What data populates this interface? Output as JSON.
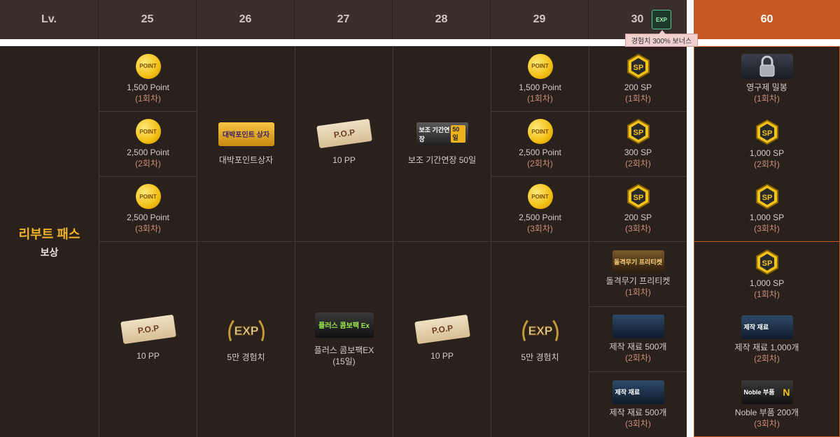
{
  "header": {
    "lv_label": "Lv.",
    "levels": [
      "25",
      "26",
      "27",
      "28",
      "29",
      "30"
    ],
    "exp_icon_text": "EXP",
    "bonus_tooltip": "경험치 300% 보너스",
    "special_level": "60"
  },
  "side": {
    "title": "리부트 패스",
    "subtitle": "보상"
  },
  "icons": {
    "point_coin": "POINT",
    "sp": "SP",
    "pp_ticket": "P.O.P",
    "exp_badge": "EXP"
  },
  "upper": {
    "c25": [
      {
        "label": "1,500 Point",
        "sub": "(1회차)"
      },
      {
        "label": "2,500 Point",
        "sub": "(2회차)"
      },
      {
        "label": "2,500 Point",
        "sub": "(3회차)"
      }
    ],
    "c26": {
      "label": "대박포인트상자",
      "icon_text": "대박포인트 상자"
    },
    "c27": {
      "label": "10 PP"
    },
    "c28": {
      "label": "보조 기간연장 50일",
      "icon_text": "보조 기간연장",
      "icon_badge": "50일"
    },
    "c29": [
      {
        "label": "1,500 Point",
        "sub": "(1회차)"
      },
      {
        "label": "2,500 Point",
        "sub": "(2회차)"
      },
      {
        "label": "2,500 Point",
        "sub": "(3회차)"
      }
    ],
    "c30": [
      {
        "label": "200 SP",
        "sub": "(1회차)"
      },
      {
        "label": "300 SP",
        "sub": "(2회차)"
      },
      {
        "label": "200 SP",
        "sub": "(3회차)"
      }
    ],
    "c60": [
      {
        "label": "영구제 밀봉",
        "sub": "(1회차)"
      },
      {
        "label": "1,000 SP",
        "sub": "(2회차)"
      },
      {
        "label": "1,000 SP",
        "sub": "(3회차)"
      }
    ]
  },
  "lower": {
    "c25": {
      "label": "10 PP"
    },
    "c26": {
      "label": "5만 경험치"
    },
    "c27": {
      "label": "플러스 콤보팩EX",
      "sub": "(15일)",
      "icon_text": "플러스 콤보팩 Ex"
    },
    "c28": {
      "label": "10 PP"
    },
    "c29": {
      "label": "5만 경험치"
    },
    "c30": [
      {
        "label": "돌격무기 프리티켓",
        "sub": "(1회차)",
        "icon_text": "돌격무기 프리티켓"
      },
      {
        "label": "제작 재료 500개",
        "sub": "(2회차)"
      },
      {
        "label": "제작 재료 500개",
        "sub": "(3회차)",
        "icon_text": "제작 재료"
      }
    ],
    "c60": [
      {
        "label": "1,000 SP",
        "sub": "(1회차)"
      },
      {
        "label": "제작 재료 1,000개",
        "sub": "(2회차)",
        "icon_text": "제작 재료"
      },
      {
        "label": "Noble 부품 200개",
        "sub": "(3회차)",
        "icon_text": "Noble 부품"
      }
    ]
  },
  "colors": {
    "panel": "#2b211c",
    "header": "#3a2f2a",
    "accent": "#c75a22",
    "gold": "#f1b327",
    "sub_text": "#c98d78"
  }
}
